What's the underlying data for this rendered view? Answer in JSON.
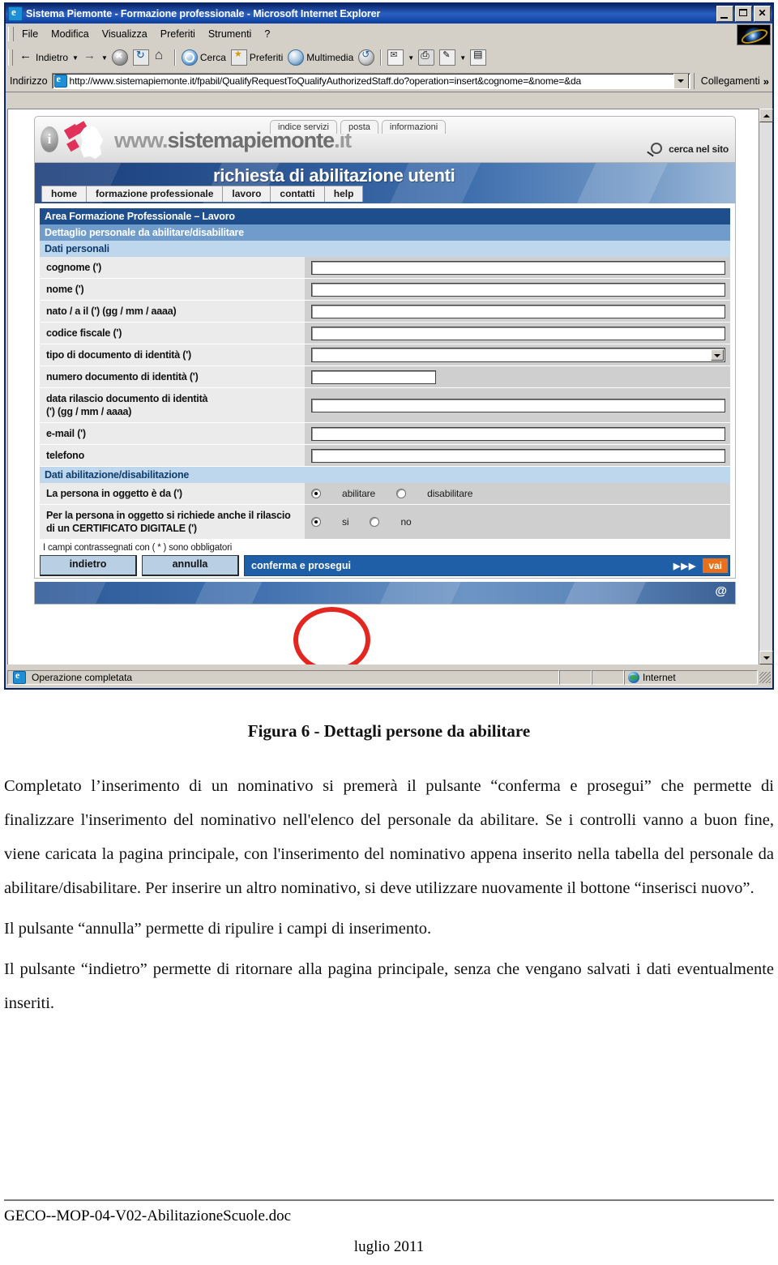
{
  "browser": {
    "title": "Sistema Piemonte - Formazione professionale - Microsoft Internet Explorer",
    "window_buttons": {
      "minimize": "_",
      "maximize": "□",
      "close": "✕"
    },
    "menu": [
      "File",
      "Modifica",
      "Visualizza",
      "Preferiti",
      "Strumenti",
      "?"
    ],
    "toolbar": {
      "back": "Indietro",
      "forward": "",
      "stop": "",
      "refresh": "",
      "home": "",
      "search": "Cerca",
      "favorites": "Preferiti",
      "media": "Multimedia",
      "history": "",
      "mail": "",
      "print": "",
      "edit": "",
      "discuss": ""
    },
    "address": {
      "label": "Indirizzo",
      "url": "http://www.sistemapiemonte.it/fpabil/QualifyRequestToQualifyAuthorizedStaff.do?operation=insert&cognome=&nome=&da",
      "links_label": "Collegamenti",
      "links_chevron": "»"
    },
    "status": {
      "message": "Operazione completata",
      "zone": "Internet"
    }
  },
  "site": {
    "info_glyph": "i",
    "wordmark_prefix": "www.",
    "wordmark_bold": "sistemapiemonte",
    "wordmark_suffix": ".it",
    "tabs": [
      "indice servizi",
      "posta",
      "informazioni"
    ],
    "search_label": "cerca nel sito",
    "banner_title": "richiesta di abilitazione utenti",
    "nav": [
      "home",
      "formazione professionale",
      "lavoro",
      "contatti",
      "help"
    ],
    "footer_at": "@"
  },
  "form": {
    "area_bar": "Area Formazione Professionale – Lavoro",
    "detail_bar": "Dettaglio personale da abilitare/disabilitare",
    "section_personal": "Dati personali",
    "section_enable": "Dati abilitazione/disabilitazione",
    "fields": [
      {
        "label": "cognome (')",
        "type": "text",
        "value": "",
        "width": "wide"
      },
      {
        "label": "nome (')",
        "type": "text",
        "value": "",
        "width": "wide"
      },
      {
        "label": "nato / a il (') (gg / mm / aaaa)",
        "type": "text",
        "value": "",
        "width": "wide"
      },
      {
        "label": "codice fiscale (')",
        "type": "text",
        "value": "",
        "width": "wide"
      },
      {
        "label": "tipo di documento di identità (')",
        "type": "select",
        "value": "",
        "width": "wide"
      },
      {
        "label": "numero documento di identità (')",
        "type": "text",
        "value": "",
        "width": "short"
      },
      {
        "label": "data rilascio documento di identità\n(') (gg / mm / aaaa)",
        "type": "text",
        "value": "",
        "width": "wide"
      },
      {
        "label": "e-mail (')",
        "type": "text",
        "value": "",
        "width": "wide"
      },
      {
        "label": "telefono",
        "type": "text",
        "value": "",
        "width": "wide"
      }
    ],
    "radio_rows": [
      {
        "label": "La persona in oggetto è da (')",
        "options": [
          {
            "text": "abilitare",
            "selected": true
          },
          {
            "text": "disabilitare",
            "selected": false
          }
        ]
      },
      {
        "label": "Per la persona in oggetto si richiede anche il rilascio di un CERTIFICATO DIGITALE (')",
        "options": [
          {
            "text": "si",
            "selected": true
          },
          {
            "text": "no",
            "selected": false
          }
        ]
      }
    ],
    "required_note": "I campi contrassegnati con ( * ) sono obbligatori",
    "buttons": {
      "back": "indietro",
      "cancel": "annulla",
      "confirm": "conferma e prosegui",
      "arrows": "▶▶▶",
      "go": "vai"
    }
  },
  "document": {
    "figure_caption": "Figura 6 - Dettagli persone da abilitare",
    "paragraphs": [
      "Completato l’inserimento di un nominativo si premerà il pulsante “conferma e prosegui” che permette di finalizzare l'inserimento del nominativo nell'elenco del personale da abilitare. Se i controlli vanno a buon fine, viene caricata la pagina principale, con l'inserimento del nominativo appena inserito nella tabella del personale da abilitare/disabilitare. Per inserire un altro nominativo, si deve utilizzare nuovamente il bottone “inserisci nuovo”.",
      "Il pulsante “annulla” permette di ripulire i campi di inserimento.",
      "Il pulsante “indietro” permette di ritornare alla pagina principale, senza che vengano salvati i dati eventualmente inseriti."
    ],
    "footer_filename": "GECO--MOP-04-V02-AbilitazioneScuole.doc",
    "footer_date": "luglio 2011"
  }
}
